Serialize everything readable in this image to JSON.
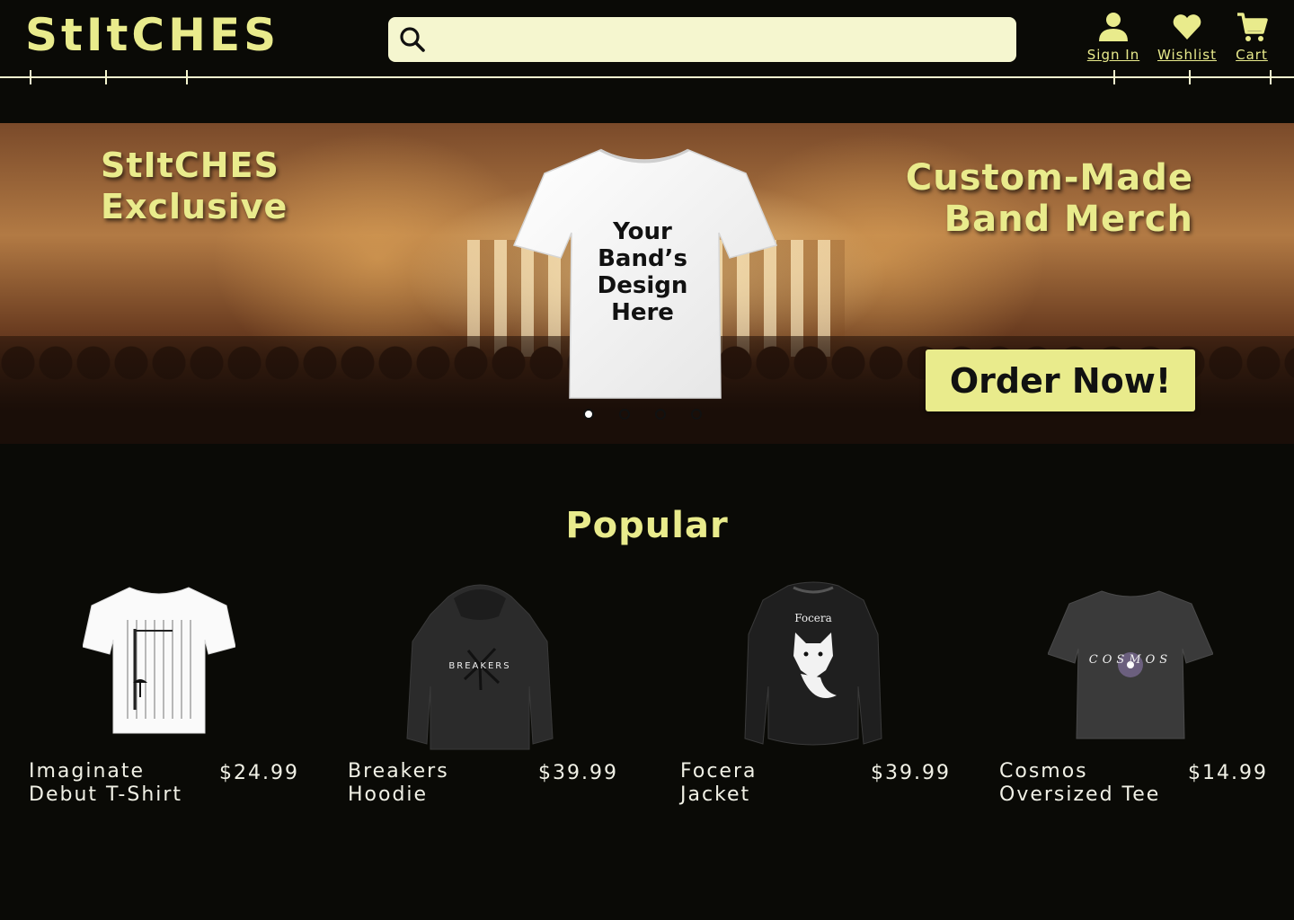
{
  "brand": {
    "logo": "StItCHES"
  },
  "search": {
    "placeholder": "",
    "value": ""
  },
  "nav": {
    "sign_in": "Sign In",
    "wishlist": "Wishlist",
    "cart": "Cart"
  },
  "banner": {
    "left_line1": "StItCHES",
    "left_line2": "Exclusive",
    "right_line1": "Custom-Made",
    "right_line2": "Band Merch",
    "tshirt_line1": "Your",
    "tshirt_line2": "Band’s",
    "tshirt_line3": "Design",
    "tshirt_line4": "Here",
    "cta": "Order Now!",
    "slides": 4,
    "active_slide": 1
  },
  "popular": {
    "title": "Popular",
    "products": [
      {
        "name": "Imaginate",
        "sub": "Debut T-Shirt",
        "price": "$24.99",
        "print": ""
      },
      {
        "name": "Breakers",
        "sub": "Hoodie",
        "price": "$39.99",
        "print": "BREAKERS"
      },
      {
        "name": "Focera",
        "sub": "Jacket",
        "price": "$39.99",
        "print": "Focera"
      },
      {
        "name": "Cosmos",
        "sub": "Oversized Tee",
        "price": "$14.99",
        "print": "COSMOS"
      }
    ]
  },
  "colors": {
    "accent": "#e9eb8c",
    "background": "#0a0a06",
    "search_bg": "#f5f6cf"
  }
}
